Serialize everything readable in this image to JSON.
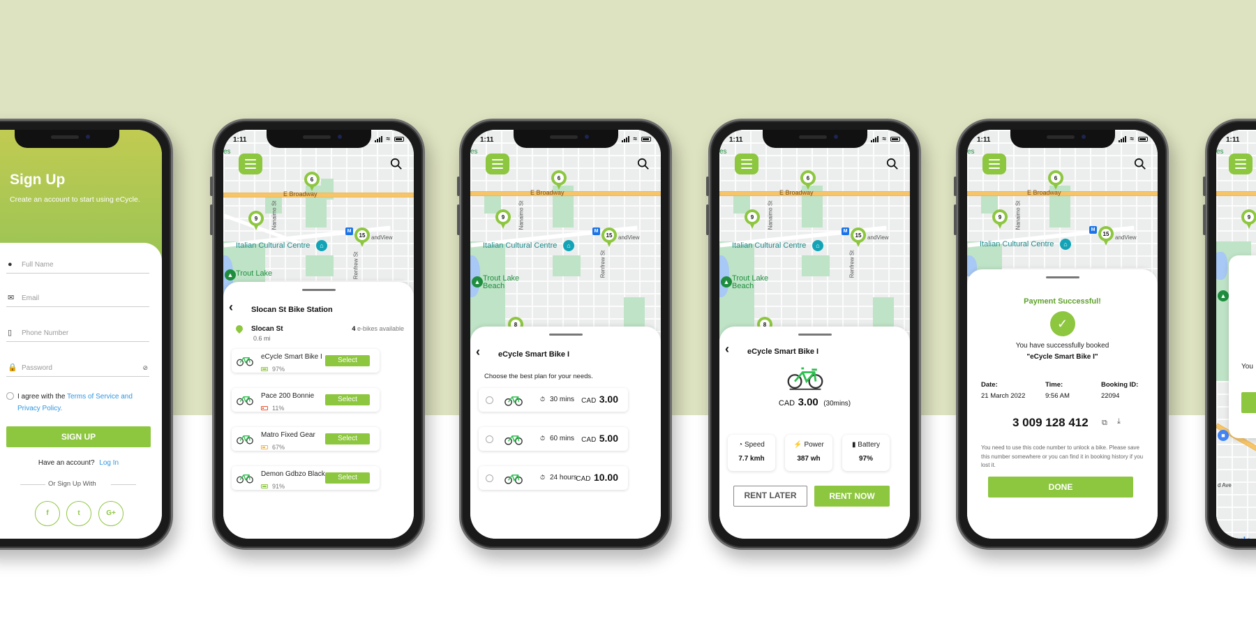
{
  "colors": {
    "accent": "#8dc63f",
    "background_top": "#dde2c0",
    "link": "#2f96e0",
    "battery_high": "#8dc63f",
    "battery_low": "#e8542e",
    "battery_mid": "#f2b53c",
    "success_text": "#5ea02a"
  },
  "status_bar": {
    "time": "1:11"
  },
  "map": {
    "road_label": "E Broadway",
    "street_1": "Nanaimo St",
    "street_2": "Renfrew St",
    "poi_label": "Italian Cultural Centre",
    "park_label_short": "Trout Lake",
    "park_label_line1": "Trout Lake",
    "park_label_line2": "Beach",
    "area_label": "andView",
    "edge_label": "es",
    "metro_label": "M",
    "pins": [
      "6",
      "9",
      "15",
      "8"
    ],
    "google_label": "Google",
    "avenue_label": "d Ave"
  },
  "signup": {
    "title": "Sign Up",
    "subtitle": "Create an account to start using eCycle.",
    "fields": [
      {
        "placeholder": "Full Name",
        "icon": "person-icon"
      },
      {
        "placeholder": "Email",
        "icon": "mail-icon"
      },
      {
        "placeholder": "Phone Number",
        "icon": "phone-icon"
      },
      {
        "placeholder": "Password",
        "icon": "lock-icon"
      }
    ],
    "agree_text": "I agree with the ",
    "terms_link": "Terms of Service and",
    "privacy_link": "Privacy Policy.",
    "button": "SIGN UP",
    "have_account": "Have an account?",
    "login_link": "Log In",
    "or_label": "Or Sign Up With",
    "social": [
      "f",
      "t",
      "G+"
    ]
  },
  "station": {
    "title": "Slocan St Bike Station",
    "location_name": "Slocan St",
    "distance": "0.6 mi",
    "available_count": "4",
    "available_label": "e-bikes available",
    "bikes": [
      {
        "name": "eCycle Smart Bike I",
        "battery": "97%",
        "level": "high",
        "button": "Select"
      },
      {
        "name": "Pace 200 Bonnie",
        "battery": "11%",
        "level": "low",
        "button": "Select"
      },
      {
        "name": "Matro Fixed Gear",
        "battery": "67%",
        "level": "mid",
        "button": "Select"
      },
      {
        "name": "Demon Gdbzo Black",
        "battery": "91%",
        "level": "high",
        "button": "Select"
      }
    ]
  },
  "plans": {
    "title": "eCycle Smart Bike I",
    "subtitle": "Choose the best plan for your needs.",
    "options": [
      {
        "duration": "30 mins",
        "currency": "CAD",
        "price": "3.00"
      },
      {
        "duration": "60 mins",
        "currency": "CAD",
        "price": "5.00"
      },
      {
        "duration": "24 hours",
        "currency": "CAD",
        "price": "10.00"
      }
    ]
  },
  "detail": {
    "title": "eCycle Smart Bike I",
    "currency": "CAD",
    "price": "3.00",
    "period": "(30mins)",
    "stats": [
      {
        "label": "Speed",
        "value": "7.7 kmh",
        "icon": "speedometer-icon"
      },
      {
        "label": "Power",
        "value": "387 wh",
        "icon": "lightning-icon"
      },
      {
        "label": "Battery",
        "value": "97%",
        "icon": "battery-icon"
      }
    ],
    "rent_later": "RENT LATER",
    "rent_now": "RENT NOW"
  },
  "payment": {
    "title": "Payment Successful!",
    "booked_text": "You have successfully booked",
    "bike_name": "\"eCycle Smart Bike I\"",
    "date_label": "Date:",
    "date_value": "21 March 2022",
    "time_label": "Time:",
    "time_value": "9:56 AM",
    "booking_label": "Booking ID:",
    "booking_value": "22094",
    "code": "3 009 128 412",
    "note": "You need to use this code number to unlock a bike. Please save this number somewhere or you can find it in booking history if you lost it.",
    "done": "DONE"
  },
  "partial": {
    "text": "You"
  }
}
